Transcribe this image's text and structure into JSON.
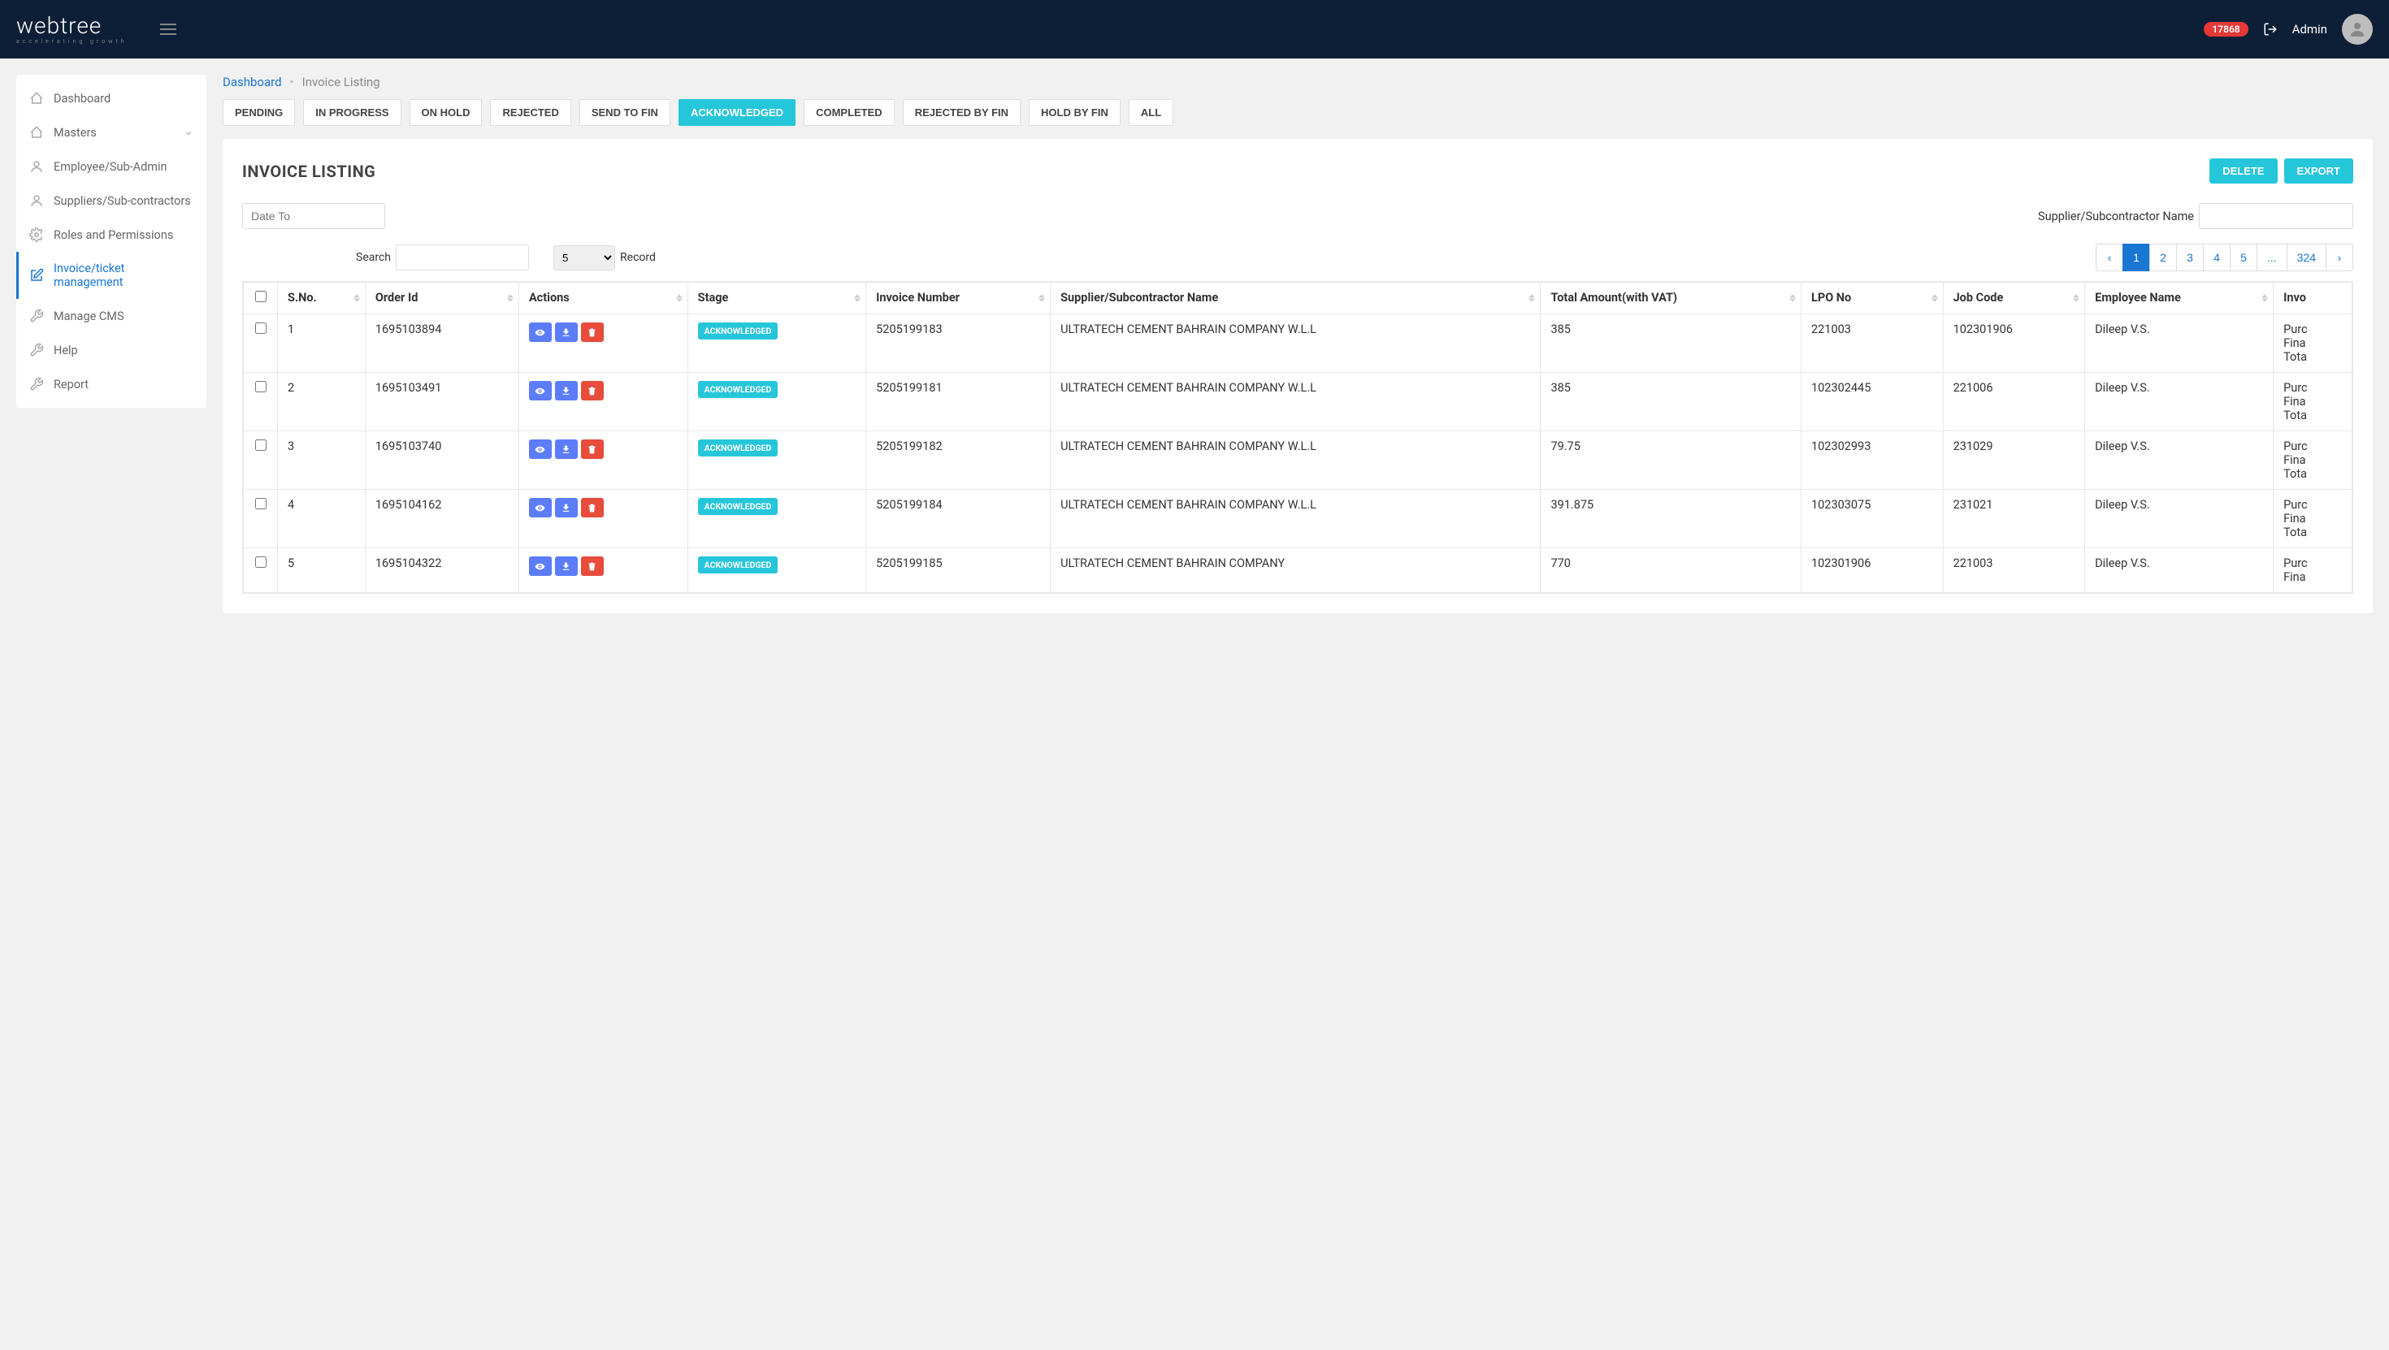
{
  "header": {
    "logo_main": "webtree",
    "logo_sub": "accelerating growth",
    "notification_count": "17868",
    "username": "Admin"
  },
  "sidebar": {
    "items": [
      {
        "label": "Dashboard",
        "icon": "home"
      },
      {
        "label": "Masters",
        "icon": "home",
        "expandable": true
      },
      {
        "label": "Employee/Sub-Admin",
        "icon": "user"
      },
      {
        "label": "Suppliers/Sub-contractors",
        "icon": "user"
      },
      {
        "label": "Roles and Permissions",
        "icon": "gear"
      },
      {
        "label": "Invoice/ticket management",
        "icon": "edit",
        "active": true
      },
      {
        "label": "Manage CMS",
        "icon": "wrench"
      },
      {
        "label": "Help",
        "icon": "wrench"
      },
      {
        "label": "Report",
        "icon": "wrench"
      }
    ]
  },
  "breadcrumb": {
    "root": "Dashboard",
    "current": "Invoice Listing"
  },
  "filter_tabs": [
    {
      "label": "PENDING"
    },
    {
      "label": "IN PROGRESS"
    },
    {
      "label": "ON HOLD"
    },
    {
      "label": "REJECTED"
    },
    {
      "label": "SEND TO FIN"
    },
    {
      "label": "ACKNOWLEDGED",
      "active": true
    },
    {
      "label": "COMPLETED"
    },
    {
      "label": "REJECTED BY FIN"
    },
    {
      "label": "HOLD BY FIN"
    },
    {
      "label": "ALL"
    }
  ],
  "panel": {
    "title": "INVOICE LISTING",
    "delete_label": "DELETE",
    "export_label": "EXPORT",
    "date_to_placeholder": "Date To",
    "supplier_filter_label": "Supplier/Subcontractor Name",
    "search_label": "Search",
    "record_label": "Record",
    "records_per_page": "5"
  },
  "pagination": {
    "pages": [
      "1",
      "2",
      "3",
      "4",
      "5",
      "...",
      "324"
    ],
    "active": "1"
  },
  "table": {
    "columns": [
      "",
      "S.No.",
      "Order Id",
      "Actions",
      "Stage",
      "Invoice Number",
      "Supplier/Subcontractor Name",
      "Total Amount(with VAT)",
      "LPO No",
      "Job Code",
      "Employee Name",
      "Invo"
    ],
    "rows": [
      {
        "sno": "1",
        "order_id": "1695103894",
        "stage": "ACKNOWLEDGED",
        "invoice_number": "5205199183",
        "supplier": "ULTRATECH CEMENT BAHRAIN COMPANY W.L.L",
        "amount": "385",
        "lpo": "221003",
        "job_code": "102301906",
        "employee": "Dileep V.S.",
        "extra": "Purc\nFina\nTota"
      },
      {
        "sno": "2",
        "order_id": "1695103491",
        "stage": "ACKNOWLEDGED",
        "invoice_number": "5205199181",
        "supplier": "ULTRATECH CEMENT BAHRAIN COMPANY W.L.L",
        "amount": "385",
        "lpo": "102302445",
        "job_code": "221006",
        "employee": "Dileep V.S.",
        "extra": "Purc\nFina\nTota"
      },
      {
        "sno": "3",
        "order_id": "1695103740",
        "stage": "ACKNOWLEDGED",
        "invoice_number": "5205199182",
        "supplier": "ULTRATECH CEMENT BAHRAIN COMPANY W.L.L",
        "amount": "79.75",
        "lpo": "102302993",
        "job_code": "231029",
        "employee": "Dileep V.S.",
        "extra": "Purc\nFina\nTota"
      },
      {
        "sno": "4",
        "order_id": "1695104162",
        "stage": "ACKNOWLEDGED",
        "invoice_number": "5205199184",
        "supplier": "ULTRATECH CEMENT BAHRAIN COMPANY W.L.L",
        "amount": "391.875",
        "lpo": "102303075",
        "job_code": "231021",
        "employee": "Dileep V.S.",
        "extra": "Purc\nFina\nTota"
      },
      {
        "sno": "5",
        "order_id": "1695104322",
        "stage": "ACKNOWLEDGED",
        "invoice_number": "5205199185",
        "supplier": "ULTRATECH CEMENT BAHRAIN COMPANY",
        "amount": "770",
        "lpo": "102301906",
        "job_code": "221003",
        "employee": "Dileep V.S.",
        "extra": "Purc\nFina"
      }
    ]
  }
}
